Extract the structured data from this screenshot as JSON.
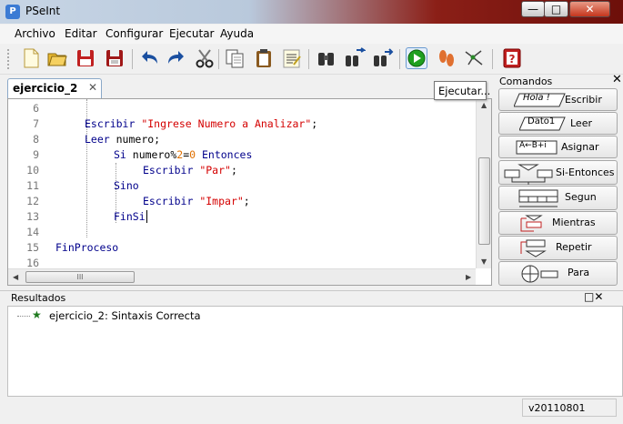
{
  "window": {
    "title": "PSeInt",
    "icon": "P",
    "min": "—",
    "max": "□",
    "close": "✕"
  },
  "menu": [
    "Archivo",
    "Editar",
    "Configurar",
    "Ejecutar",
    "Ayuda"
  ],
  "toolbar": {
    "buttons": [
      "new-icon",
      "open-icon",
      "save-icon",
      "save-as-icon",
      "undo-icon",
      "redo-icon",
      "cut-icon",
      "copy-icon",
      "paste-icon",
      "edit-list-icon",
      "search-icon",
      "replace-icon",
      "find-next-icon",
      "run-icon",
      "step-icon",
      "flowchart-icon",
      "help-icon"
    ]
  },
  "tabs": [
    {
      "label": "ejercicio_2",
      "close": "✕"
    }
  ],
  "tooltip": "Ejecutar...",
  "editor": {
    "lines": [
      {
        "n": "6",
        "code": ""
      },
      {
        "n": "7",
        "kw": "Escribir",
        "str": "\"Ingrese Numero a Analizar\"",
        "tail": ";"
      },
      {
        "n": "8",
        "kw": "Leer",
        "tail": " numero;"
      },
      {
        "n": "9",
        "kw": "Si",
        "mid": " numero%",
        "num": "2",
        "mid2": "=",
        "num2": "0",
        "kw2": " Entonces"
      },
      {
        "n": "10",
        "kw": "Escribir",
        "str": "\"Par\"",
        "tail": ";"
      },
      {
        "n": "11",
        "kw": "Sino"
      },
      {
        "n": "12",
        "kw": "Escribir",
        "str": "\"Impar\"",
        "tail": ";"
      },
      {
        "n": "13",
        "kw": "FinSi"
      },
      {
        "n": "14",
        "code": ""
      },
      {
        "n": "15",
        "kw": "FinProceso"
      },
      {
        "n": "16",
        "code": ""
      }
    ],
    "hscroll_thumb": "III"
  },
  "commands": {
    "title": "Comandos",
    "close": "✕",
    "items": [
      {
        "icon": "Hola !",
        "label": "Escribir"
      },
      {
        "icon": "Dato1",
        "label": "Leer"
      },
      {
        "icon": "A←B+i",
        "label": "Asignar"
      },
      {
        "icon": "",
        "label": "Si-Entonces"
      },
      {
        "icon": "",
        "label": "Segun"
      },
      {
        "icon": "",
        "label": "Mientras"
      },
      {
        "icon": "",
        "label": "Repetir"
      },
      {
        "icon": "",
        "label": "Para"
      }
    ]
  },
  "results": {
    "title": "Resultados",
    "controls": "□✕",
    "items": [
      {
        "icon": "★",
        "text": "ejercicio_2: Sintaxis Correcta"
      }
    ]
  },
  "status": {
    "version": "v20110801"
  },
  "colors": {
    "keyword": "#00008b",
    "string": "#d40000",
    "number": "#e07000",
    "run": "#1fa01f"
  }
}
